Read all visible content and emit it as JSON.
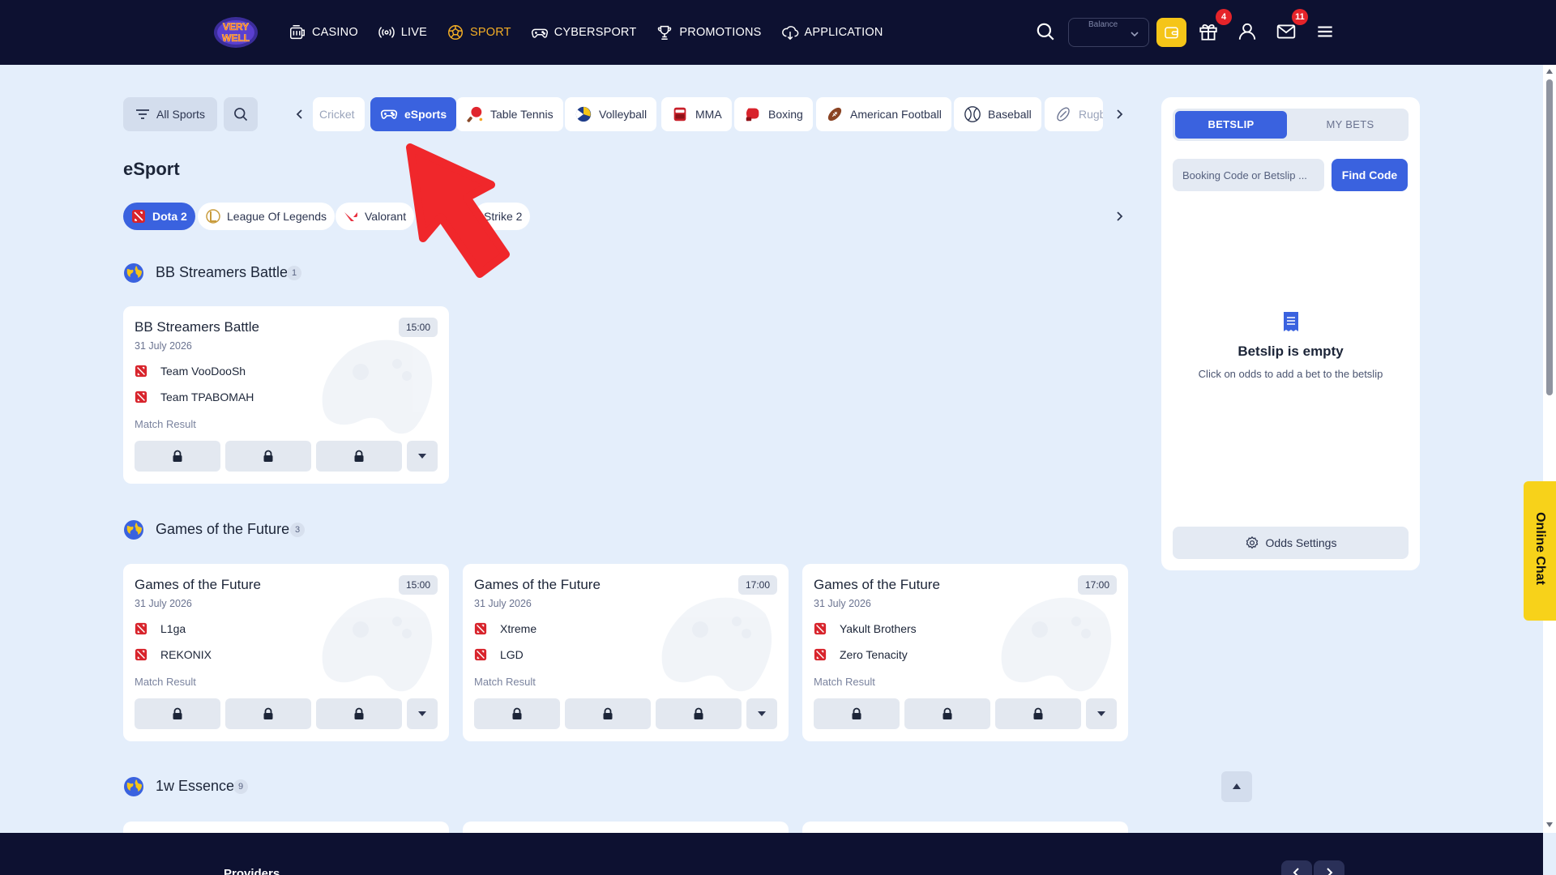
{
  "nav": {
    "items": [
      {
        "label": "CASINO",
        "icon": "casino-icon"
      },
      {
        "label": "LIVE",
        "icon": "live-icon"
      },
      {
        "label": "SPORT",
        "icon": "sport-icon",
        "active": true
      },
      {
        "label": "CYBERSPORT",
        "icon": "gamepad-icon"
      },
      {
        "label": "PROMOTIONS",
        "icon": "trophy-icon"
      },
      {
        "label": "APPLICATION",
        "icon": "download-cloud-icon"
      }
    ],
    "balance_placeholder": "Balance",
    "gift_badge": "4",
    "mail_badge": "11"
  },
  "sports_bar": {
    "all_sports_label": "All Sports",
    "chips": [
      {
        "label": "Cricket"
      },
      {
        "label": "eSports",
        "active": true
      },
      {
        "label": "Table Tennis"
      },
      {
        "label": "Volleyball"
      },
      {
        "label": "MMA"
      },
      {
        "label": "Boxing"
      },
      {
        "label": "American Football"
      },
      {
        "label": "Baseball"
      },
      {
        "label": "Rugb"
      }
    ]
  },
  "page_title": "eSport",
  "categories": [
    {
      "label": "Dota 2",
      "active": true
    },
    {
      "label": "League Of Legends"
    },
    {
      "label": "Valorant"
    },
    {
      "label": "Strike 2"
    }
  ],
  "leagues": [
    {
      "name": "BB Streamers Battle",
      "count": "1",
      "matches": [
        {
          "title": "BB Streamers Battle",
          "time": "15:00",
          "date": "31 July 2026",
          "team1": "Team VooDooSh",
          "team2": "Team TPABOMAH",
          "market": "Match Result"
        }
      ]
    },
    {
      "name": "Games of the Future",
      "count": "3",
      "matches": [
        {
          "title": "Games of the Future",
          "time": "15:00",
          "date": "31 July 2026",
          "team1": "L1ga",
          "team2": "REKONIX",
          "market": "Match Result"
        },
        {
          "title": "Games of the Future",
          "time": "17:00",
          "date": "31 July 2026",
          "team1": "Xtreme",
          "team2": "LGD",
          "market": "Match Result"
        },
        {
          "title": "Games of the Future",
          "time": "17:00",
          "date": "31 July 2026",
          "team1": "Yakult Brothers",
          "team2": "Zero Tenacity",
          "market": "Match Result"
        }
      ]
    },
    {
      "name": "1w Essence",
      "count": "9"
    }
  ],
  "betslip": {
    "tab_betslip": "BETSLIP",
    "tab_my_bets": "MY BETS",
    "code_placeholder": "Booking Code or Betslip ...",
    "find_code": "Find Code",
    "empty_title": "Betslip is empty",
    "empty_sub": "Click on odds to add a bet to the betslip",
    "odds_settings": "Odds Settings"
  },
  "online_chat": "Online Chat",
  "footer": {
    "providers": "Providers"
  },
  "colors": {
    "nav_bg": "#0d1131",
    "page_bg": "#e4eefb",
    "accent_blue": "#3a62df",
    "active_nav": "#f4ae25",
    "wallet_yellow": "#f5c518",
    "badge_red": "#e5242a",
    "pointer_red": "#f0272b"
  }
}
